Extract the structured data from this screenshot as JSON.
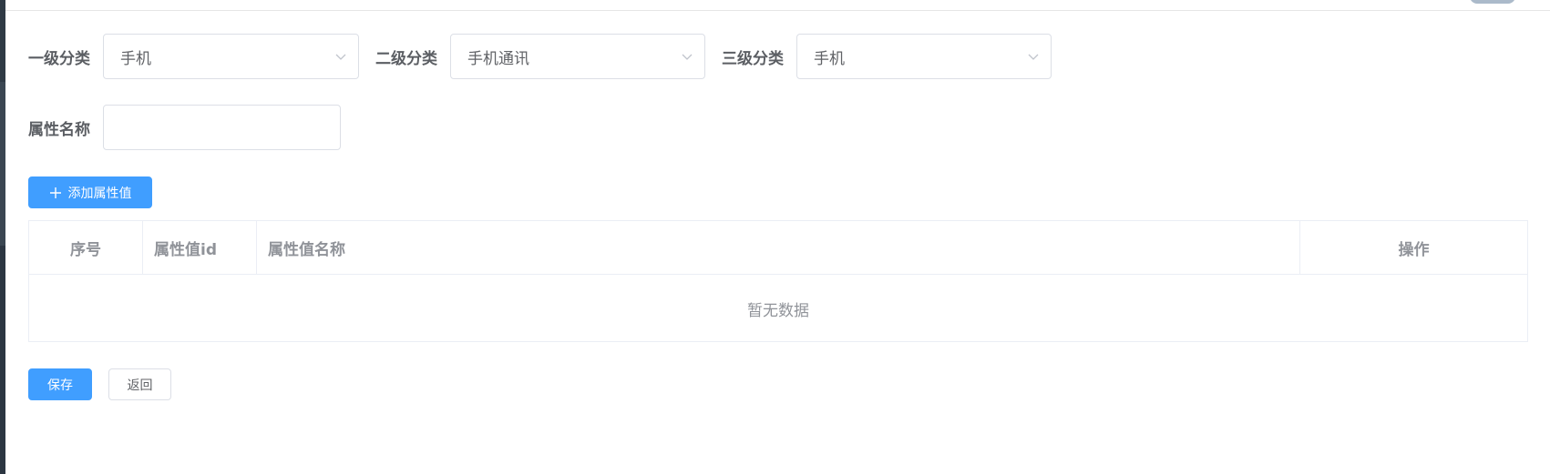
{
  "filters": {
    "level1": {
      "label": "一级分类",
      "value": "手机"
    },
    "level2": {
      "label": "二级分类",
      "value": "手机通讯"
    },
    "level3": {
      "label": "三级分类",
      "value": "手机"
    }
  },
  "attr_form": {
    "name_label": "属性名称",
    "name_value": "",
    "name_placeholder": ""
  },
  "add_button": {
    "icon": "plus-icon",
    "label": "添加属性值"
  },
  "table": {
    "columns": [
      "序号",
      "属性值id",
      "属性值名称",
      "操作"
    ],
    "empty_text": "暂无数据"
  },
  "footer": {
    "save_label": "保存",
    "back_label": "返回"
  },
  "colors": {
    "primary": "#409eff",
    "border": "#dcdfe6",
    "text": "#606266",
    "muted": "#909399"
  }
}
